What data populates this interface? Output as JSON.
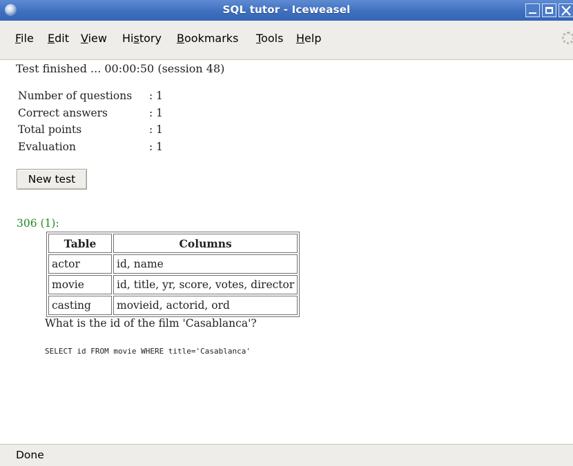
{
  "window": {
    "title": "SQL tutor - Iceweasel"
  },
  "menu": {
    "items": [
      {
        "label": "File",
        "ul": "F",
        "rest": "ile"
      },
      {
        "label": "Edit",
        "ul": "E",
        "rest": "dit"
      },
      {
        "label": "View",
        "ul": "V",
        "rest": "iew"
      },
      {
        "label": "History",
        "pre": "Hi",
        "ul": "s",
        "rest": "tory"
      },
      {
        "label": "Bookmarks",
        "ul": "B",
        "rest": "ookmarks"
      },
      {
        "label": "Tools",
        "ul": "T",
        "rest": "ools"
      },
      {
        "label": "Help",
        "ul": "H",
        "rest": "elp"
      }
    ]
  },
  "content": {
    "status": "Test finished ...  00:00:50  (session 48)",
    "stats": [
      {
        "label": "Number of questions",
        "value": ": 1"
      },
      {
        "label": "Correct answers",
        "value": ": 1"
      },
      {
        "label": "Total points",
        "value": ": 1"
      },
      {
        "label": "Evaluation",
        "value": ": 1"
      }
    ],
    "new_test_label": "New test",
    "question_header": "306 (1):",
    "schema": {
      "headers": [
        "Table",
        "Columns"
      ],
      "rows": [
        [
          "actor",
          "id, name"
        ],
        [
          "movie",
          "id, title, yr, score, votes, director"
        ],
        [
          "casting",
          "movieid, actorid, ord"
        ]
      ]
    },
    "question_text": "What is the id of the film 'Casablanca'?",
    "answer_sql": "SELECT id FROM movie WHERE title='Casablanca'"
  },
  "statusbar": {
    "text": "Done"
  },
  "colors": {
    "titlebar": "#3f6fbf",
    "question_header": "#1f8a1f",
    "chrome": "#efede9"
  }
}
